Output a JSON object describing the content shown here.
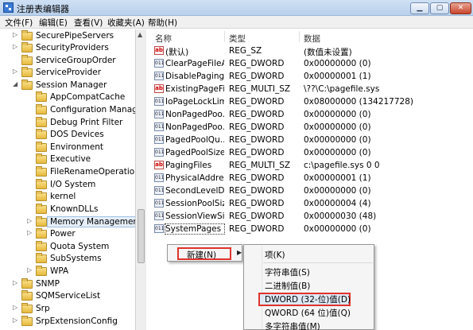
{
  "window": {
    "title": "注册表编辑器"
  },
  "menubar": [
    "文件(F)",
    "编辑(E)",
    "查看(V)",
    "收藏夹(A)",
    "帮助(H)"
  ],
  "tree": [
    {
      "label": "SecurePipeServers",
      "expander": "▷"
    },
    {
      "label": "SecurityProviders",
      "expander": "▷"
    },
    {
      "label": "ServiceGroupOrder",
      "expander": ""
    },
    {
      "label": "ServiceProvider",
      "expander": "▷"
    },
    {
      "label": "Session Manager",
      "expander": "◢"
    },
    {
      "label": "AppCompatCache",
      "expander": ""
    },
    {
      "label": "Configuration Manager",
      "expander": ""
    },
    {
      "label": "Debug Print Filter",
      "expander": ""
    },
    {
      "label": "DOS Devices",
      "expander": ""
    },
    {
      "label": "Environment",
      "expander": ""
    },
    {
      "label": "Executive",
      "expander": ""
    },
    {
      "label": "FileRenameOperations",
      "expander": ""
    },
    {
      "label": "I/O System",
      "expander": ""
    },
    {
      "label": "kernel",
      "expander": ""
    },
    {
      "label": "KnownDLLs",
      "expander": ""
    },
    {
      "label": "Memory Management",
      "expander": "▷"
    },
    {
      "label": "Power",
      "expander": "▷"
    },
    {
      "label": "Quota System",
      "expander": ""
    },
    {
      "label": "SubSystems",
      "expander": ""
    },
    {
      "label": "WPA",
      "expander": "▷"
    },
    {
      "label": "SNMP",
      "expander": "▷"
    },
    {
      "label": "SQMServiceList",
      "expander": ""
    },
    {
      "label": "Srp",
      "expander": "▷"
    },
    {
      "label": "SrpExtensionConfig",
      "expander": "▷"
    }
  ],
  "list": {
    "headers": {
      "name": "名称",
      "type": "类型",
      "data": "数据"
    },
    "rows": [
      {
        "icon": "ab",
        "name": "(默认)",
        "type": "REG_SZ",
        "data": "(数值未设置)"
      },
      {
        "icon": "011",
        "name": "ClearPageFileA...",
        "type": "REG_DWORD",
        "data": "0x00000000 (0)"
      },
      {
        "icon": "011",
        "name": "DisablePaging...",
        "type": "REG_DWORD",
        "data": "0x00000001 (1)"
      },
      {
        "icon": "ab",
        "name": "ExistingPageFil...",
        "type": "REG_MULTI_SZ",
        "data": "\\??\\C:\\pagefile.sys"
      },
      {
        "icon": "011",
        "name": "IoPageLockLimit",
        "type": "REG_DWORD",
        "data": "0x08000000 (134217728)"
      },
      {
        "icon": "011",
        "name": "NonPagedPoo...",
        "type": "REG_DWORD",
        "data": "0x00000000 (0)"
      },
      {
        "icon": "011",
        "name": "NonPagedPoo...",
        "type": "REG_DWORD",
        "data": "0x00000000 (0)"
      },
      {
        "icon": "011",
        "name": "PagedPoolQu...",
        "type": "REG_DWORD",
        "data": "0x00000000 (0)"
      },
      {
        "icon": "011",
        "name": "PagedPoolSize",
        "type": "REG_DWORD",
        "data": "0x00000000 (0)"
      },
      {
        "icon": "ab",
        "name": "PagingFiles",
        "type": "REG_MULTI_SZ",
        "data": "c:\\pagefile.sys 0 0"
      },
      {
        "icon": "011",
        "name": "PhysicalAddres...",
        "type": "REG_DWORD",
        "data": "0x00000001 (1)"
      },
      {
        "icon": "011",
        "name": "SecondLevelD...",
        "type": "REG_DWORD",
        "data": "0x00000000 (0)"
      },
      {
        "icon": "011",
        "name": "SessionPoolSize",
        "type": "REG_DWORD",
        "data": "0x00000004 (4)"
      },
      {
        "icon": "011",
        "name": "SessionViewSize",
        "type": "REG_DWORD",
        "data": "0x00000030 (48)"
      },
      {
        "icon": "011",
        "name": "SystemPages",
        "type": "REG_DWORD",
        "data": "0x00000000 (0)"
      }
    ]
  },
  "context_menu": {
    "new_label": "新建(N)",
    "arrow": "▶"
  },
  "submenu": {
    "key": "项(K)",
    "string": "字符串值(S)",
    "binary": "二进制值(B)",
    "dword": "DWORD (32-位)值(D)",
    "qword": "QWORD (64 位)值(Q)",
    "multi": "多字符串值(M)"
  }
}
